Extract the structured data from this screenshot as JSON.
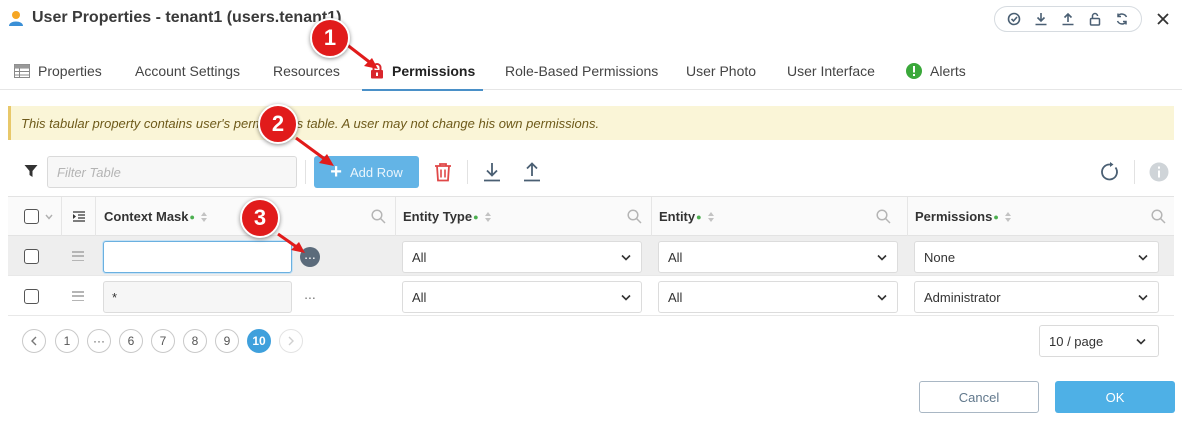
{
  "window": {
    "title": "User Properties - tenant1 (users.tenant1)",
    "tools": [
      "validate-icon",
      "download-icon",
      "upload-icon",
      "unlock-icon",
      "refresh-icon"
    ],
    "close_icon": "close-icon"
  },
  "tabs": [
    {
      "label": "Properties",
      "icon": "table-icon",
      "active": false
    },
    {
      "label": "Account Settings",
      "active": false
    },
    {
      "label": "Resources",
      "active": false
    },
    {
      "label": "Permissions",
      "icon": "lock-icon",
      "active": true
    },
    {
      "label": "Role-Based Permissions",
      "active": false
    },
    {
      "label": "User Photo",
      "active": false
    },
    {
      "label": "User Interface",
      "active": false
    },
    {
      "label": "Alerts",
      "icon": "alert-icon",
      "active": false
    }
  ],
  "banner": {
    "text": "This tabular property contains user's permissions table. A user may not change his own permissions."
  },
  "toolbar": {
    "filter_placeholder": "Filter Table",
    "add_row_label": "Add Row"
  },
  "table": {
    "columns": [
      {
        "label": "Context Mask"
      },
      {
        "label": "Entity Type"
      },
      {
        "label": "Entity"
      },
      {
        "label": "Permissions"
      }
    ],
    "rows": [
      {
        "context_mask": "",
        "entity_type": "All",
        "entity": "All",
        "permissions": "None",
        "selected": true
      },
      {
        "context_mask": "*",
        "entity_type": "All",
        "entity": "All",
        "permissions": "Administrator",
        "selected": false
      }
    ]
  },
  "pagination": {
    "pages": [
      "1",
      "···",
      "6",
      "7",
      "8",
      "9",
      "10"
    ],
    "current": "10",
    "page_size": "10 / page"
  },
  "footer": {
    "cancel_label": "Cancel",
    "ok_label": "OK"
  },
  "annotations": {
    "callout_1": "1",
    "callout_2": "2",
    "callout_3": "3"
  },
  "colors": {
    "accent": "#4eb0e6",
    "callout": "#e11b1b",
    "lock": "#d9262c",
    "alert": "#3aa83a",
    "delete": "#e04848"
  }
}
